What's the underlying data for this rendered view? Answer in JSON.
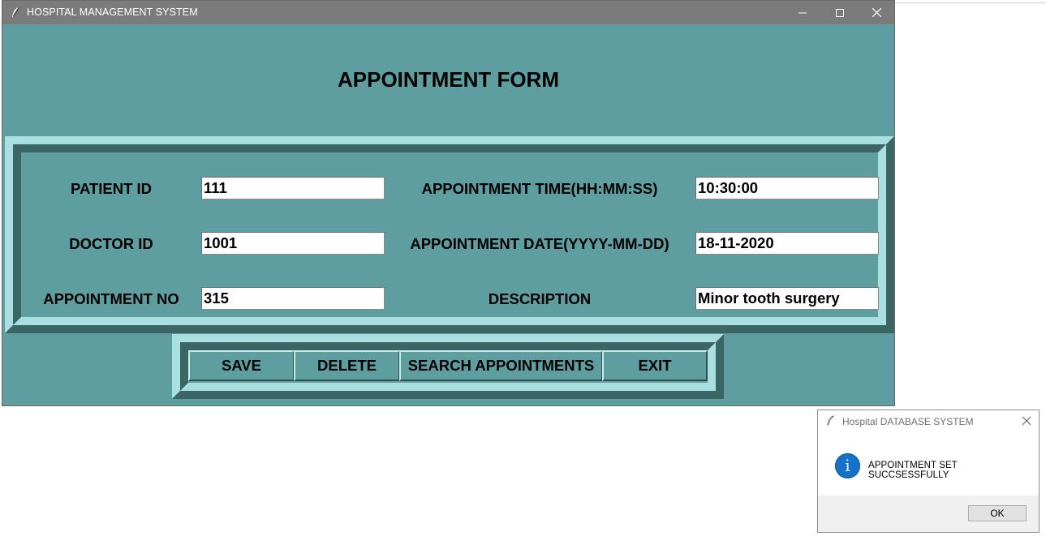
{
  "window": {
    "title": "HOSPITAL MANAGEMENT SYSTEM",
    "controls": {
      "minimize": "minimize-icon",
      "maximize": "maximize-icon",
      "close": "close-icon"
    }
  },
  "form": {
    "title": "APPOINTMENT FORM",
    "fields": {
      "patient_id": {
        "label": "PATIENT ID",
        "value": "111"
      },
      "doctor_id": {
        "label": "DOCTOR ID",
        "value": "1001"
      },
      "appointment_no": {
        "label": "APPOINTMENT NO",
        "value": "315"
      },
      "appointment_time": {
        "label": "APPOINTMENT TIME(HH:MM:SS)",
        "value": "10:30:00"
      },
      "appointment_date": {
        "label": "APPOINTMENT DATE(YYYY-MM-DD)",
        "value": "18-11-2020"
      },
      "description": {
        "label": "DESCRIPTION",
        "value": "Minor tooth surgery"
      }
    }
  },
  "buttons": {
    "save": "SAVE",
    "delete": "DELETE",
    "search": "SEARCH APPOINTMENTS",
    "exit": "EXIT"
  },
  "dialog": {
    "title": "Hospital DATABASE SYSTEM",
    "message": "APPOINTMENT SET SUCCSESSFULLY",
    "ok": "OK",
    "icon": "info-icon"
  },
  "colors": {
    "background": "#5f9ea0",
    "bevel_light": "#a9dfe0",
    "bevel_dark": "#3c6566",
    "titlebar": "#7b7b7b",
    "info_icon": "#1473c9"
  }
}
